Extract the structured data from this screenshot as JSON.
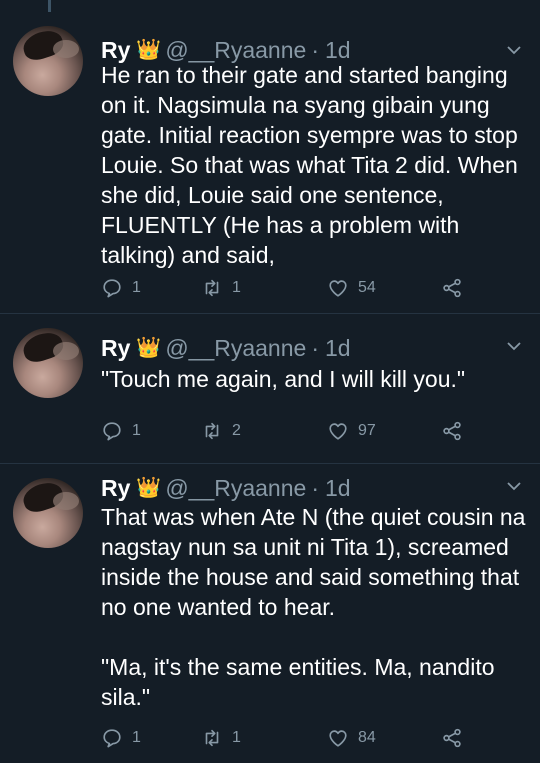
{
  "tweets": [
    {
      "name": "Ry",
      "handle": "@__Ryaanne",
      "dot": "·",
      "time": "1d",
      "text": "He ran to their gate and started banging\non it. Nagsimula na syang gibain yung\ngate. Initial reaction syempre was to stop\nLouie. So that was what Tita 2 did. When\nshe did, Louie said one sentence,\nFLUENTLY (He has a problem with\ntalking) and said,",
      "replies": "1",
      "retweets": "1",
      "likes": "54"
    },
    {
      "name": "Ry",
      "handle": "@__Ryaanne",
      "dot": "·",
      "time": "1d",
      "text": "\"Touch me again, and I will kill you.\"",
      "replies": "1",
      "retweets": "2",
      "likes": "97"
    },
    {
      "name": "Ry",
      "handle": "@__Ryaanne",
      "dot": "·",
      "time": "1d",
      "text": "That was when Ate N (the quiet cousin na\nnagstay nun sa unit ni Tita 1), screamed\ninside the house and said something that\nno one wanted to hear.\n\n\"Ma, it's the same entities. Ma, nandito\nsila.\"",
      "replies": "1",
      "retweets": "1",
      "likes": "84"
    }
  ],
  "colors": {
    "background": "#141d26",
    "text": "#ffffff",
    "muted": "#8899a6",
    "crown": "#f5c518"
  },
  "icons": [
    "crown-emoji",
    "chevron-down-icon",
    "reply-icon",
    "retweet-icon",
    "like-icon",
    "share-icon"
  ]
}
